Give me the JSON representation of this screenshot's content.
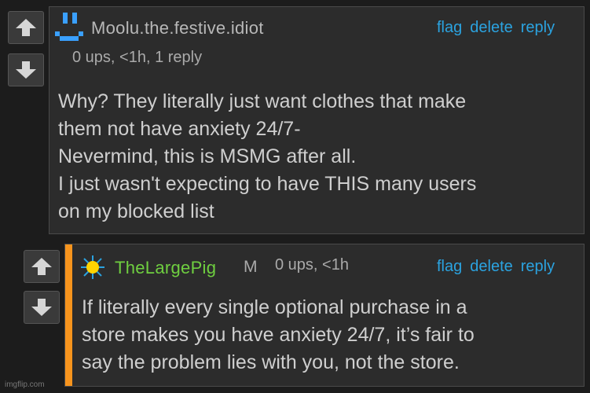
{
  "colors": {
    "link": "#2ba3e0",
    "reply_bar": "#f7941d",
    "username_green": "#6fcf40"
  },
  "comment1": {
    "username": "Moolu.the.festive.idiot",
    "meta": "0 ups, <1h, 1 reply",
    "actions": [
      "flag",
      "delete",
      "reply"
    ],
    "lines": [
      "Why? They literally just want clothes that make",
      "them not have anxiety 24/7-",
      "Nevermind, this is MSMG after all.",
      "I just wasn't expecting to have THIS many users",
      "on my blocked list"
    ],
    "avatar_icon": "pixel-face-icon"
  },
  "comment2": {
    "username": "TheLargePig",
    "badge": "M",
    "meta": "0 ups, <1h",
    "actions": [
      "flag",
      "delete",
      "reply"
    ],
    "lines": [
      "If literally every single optional purchase in a",
      "store makes you have anxiety 24/7, it’s fair to",
      "say the problem lies with you, not the store."
    ],
    "avatar_icon": "sun-icon"
  },
  "watermark": "imgflip.com"
}
